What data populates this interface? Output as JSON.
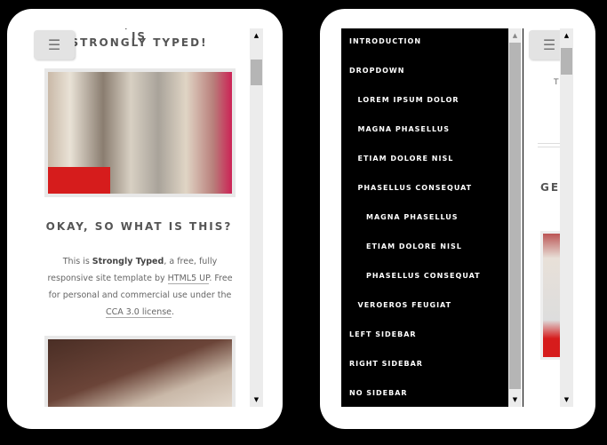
{
  "left_phone": {
    "cut_title": "GENTLEMEN, BEHOLD! THIS IS",
    "title": "STRONGLY TYPED!",
    "menu_icon": "hamburger-icon",
    "heading": "OKAY, SO WHAT IS THIS?",
    "text": {
      "p1": "This is ",
      "strong": "Strongly Typed",
      "p2": ", a free, fully responsive site template by ",
      "link1": "HTML5 UP",
      "p3": ". Free for personal and commercial use under the ",
      "link2": "CCA 3.0 license",
      "p4": "."
    }
  },
  "right_phone": {
    "menu_items": [
      {
        "label": "INTRODUCTION",
        "level": 0
      },
      {
        "label": "DROPDOWN",
        "level": 0
      },
      {
        "label": "LOREM IPSUM DOLOR",
        "level": 1
      },
      {
        "label": "MAGNA PHASELLUS",
        "level": 1
      },
      {
        "label": "ETIAM DOLORE NISL",
        "level": 1
      },
      {
        "label": "PHASELLUS CONSEQUAT",
        "level": 1
      },
      {
        "label": "MAGNA PHASELLUS",
        "level": 2
      },
      {
        "label": "ETIAM DOLORE NISL",
        "level": 2
      },
      {
        "label": "PHASELLUS CONSEQUAT",
        "level": 2
      },
      {
        "label": "VEROEROS FEUGIAT",
        "level": 1
      },
      {
        "label": "LEFT SIDEBAR",
        "level": 0
      },
      {
        "label": "RIGHT SIDEBAR",
        "level": 0
      },
      {
        "label": "NO SIDEBAR",
        "level": 0
      }
    ],
    "cut_t": "T",
    "cut_heading": "GEN"
  }
}
